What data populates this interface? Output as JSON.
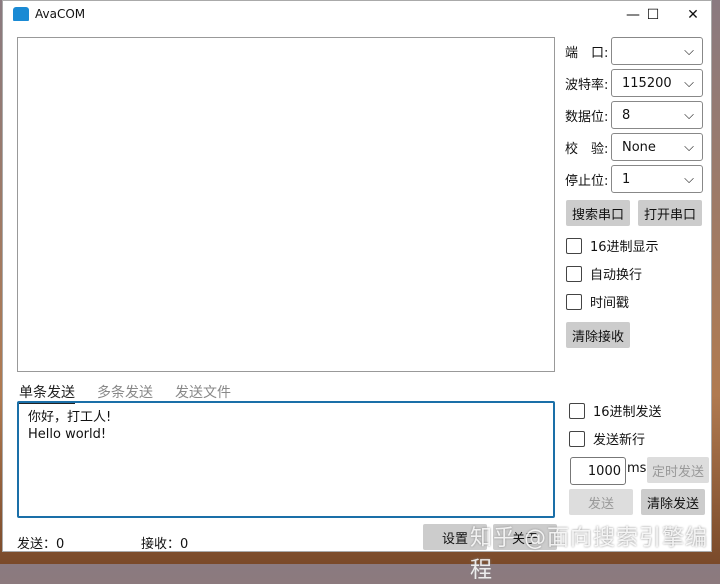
{
  "window": {
    "title": "AvaCOM",
    "minimize": "—",
    "maximize": "☐",
    "close": "✕"
  },
  "settings": [
    {
      "label": "端　口:",
      "value": ""
    },
    {
      "label": "波特率:",
      "value": "115200"
    },
    {
      "label": "数据位:",
      "value": "8"
    },
    {
      "label": "校　验:",
      "value": "None"
    },
    {
      "label": "停止位:",
      "value": "1"
    }
  ],
  "buttons": {
    "search": "搜索串口",
    "open": "打开串口",
    "clear_recv": "清除接收",
    "timed_send": "定时发送",
    "send": "发送",
    "clear_send": "清除发送",
    "settings": "设置",
    "about": "关于"
  },
  "recv_options": {
    "hex_display": "16进制显示",
    "auto_wrap": "自动换行",
    "timestamp": "时间戳"
  },
  "send_options": {
    "hex_send": "16进制发送",
    "newline": "发送新行",
    "interval": "1000",
    "unit": "ms"
  },
  "tabs": [
    "单条发送",
    "多条发送",
    "发送文件"
  ],
  "send_text": [
    "你好，打工人!",
    "Hello world!"
  ],
  "status": {
    "sent": "发送：0",
    "received": "接收：0"
  },
  "watermark": "知乎 @面向搜索引擎编程"
}
